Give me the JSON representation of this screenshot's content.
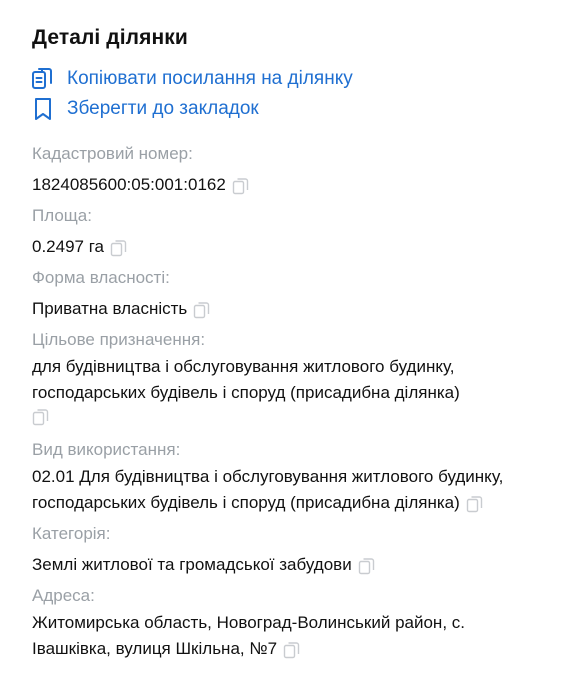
{
  "title": "Деталі ділянки",
  "actions": {
    "copy_link_label": "Копіювати посилання на ділянку",
    "bookmark_label": "Зберегти до закладок"
  },
  "fields": {
    "cadastral": {
      "label": "Кадастровий номер:",
      "value": "1824085600:05:001:0162"
    },
    "area": {
      "label": "Площа:",
      "value": "0.2497 га"
    },
    "ownership": {
      "label": "Форма власності:",
      "value": "Приватна власність"
    },
    "purpose": {
      "label": "Цільове призначення:",
      "value": "для будівництва і обслуговування житлового будинку, господарських будівель і споруд (присадибна ділянка)"
    },
    "usage": {
      "label": "Вид використання:",
      "value": "02.01 Для будівництва і обслуговування житлового будинку, господарських будівель і споруд (присадибна ділянка)"
    },
    "category": {
      "label": "Категорія:",
      "value": "Землі житлової та громадської забудови"
    },
    "address": {
      "label": "Адреса:",
      "value": "Житомирська область, Новоград-Волинський район, с. Івашківка, вулиця Шкільна, №7"
    }
  },
  "colors": {
    "accent": "#1f6fd1",
    "label": "#9aa0a6",
    "text": "#111111",
    "copy_icon": "#c9ccd0"
  },
  "icons": {
    "copy_link": "clipboard-copy-icon",
    "bookmark": "bookmark-icon",
    "copy": "copy-icon"
  }
}
